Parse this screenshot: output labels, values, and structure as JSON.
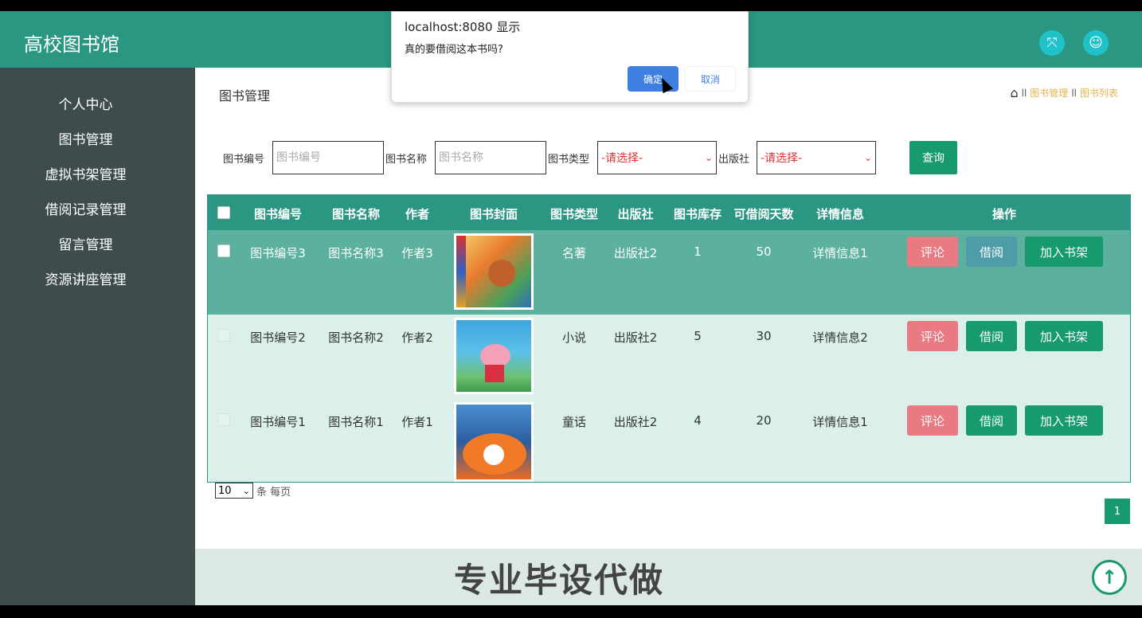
{
  "header": {
    "app_title": "高校图书馆",
    "icons": [
      "fullscreen-icon",
      "user-icon"
    ]
  },
  "sidebar": {
    "items": [
      {
        "label": "个人中心"
      },
      {
        "label": "图书管理"
      },
      {
        "label": "虚拟书架管理"
      },
      {
        "label": "借阅记录管理"
      },
      {
        "label": "留言管理"
      },
      {
        "label": "资源讲座管理"
      }
    ]
  },
  "page": {
    "title": "图书管理",
    "breadcrumb": [
      "图书管理",
      "图书列表"
    ]
  },
  "search": {
    "code_label": "图书编号",
    "code_placeholder": "图书编号",
    "name_label": "图书名称",
    "name_placeholder": "图书名称",
    "type_label": "图书类型",
    "type_value": "-请选择-",
    "publisher_label": "出版社",
    "publisher_value": "-请选择-",
    "query_label": "查询"
  },
  "table": {
    "headers": [
      "图书编号",
      "图书名称",
      "作者",
      "图书封面",
      "图书类型",
      "出版社",
      "图书库存",
      "可借阅天数",
      "详情信息",
      "操作"
    ],
    "rows": [
      {
        "code": "图书编号3",
        "name": "图书名称3",
        "author": "作者3",
        "type": "名著",
        "publisher": "出版社2",
        "stock": "1",
        "days": "50",
        "detail": "详情信息1",
        "cover": "book-cover-3",
        "selected": true
      },
      {
        "code": "图书编号2",
        "name": "图书名称2",
        "author": "作者2",
        "type": "小说",
        "publisher": "出版社2",
        "stock": "5",
        "days": "30",
        "detail": "详情信息2",
        "cover": "book-cover-2",
        "selected": false
      },
      {
        "code": "图书编号1",
        "name": "图书名称1",
        "author": "作者1",
        "type": "童话",
        "publisher": "出版社2",
        "stock": "4",
        "days": "20",
        "detail": "详情信息1",
        "cover": "book-cover-1",
        "selected": false
      }
    ],
    "actions": {
      "comment": "评论",
      "borrow": "借阅",
      "shelf": "加入书架"
    }
  },
  "pager": {
    "page_size": "10",
    "suffix": "条 每页",
    "current_page": "1"
  },
  "footer": {
    "text": "专业毕设代做"
  },
  "dialog": {
    "origin": "localhost:8080 显示",
    "message": "真的要借阅这本书吗?",
    "ok": "确定",
    "cancel": "取消"
  },
  "colors": {
    "header": "#2b9682",
    "sidebar": "#3f4c4d",
    "primary": "#179a6c",
    "comment": "#ea7a82",
    "dialog_ok": "#3f7fe0"
  }
}
